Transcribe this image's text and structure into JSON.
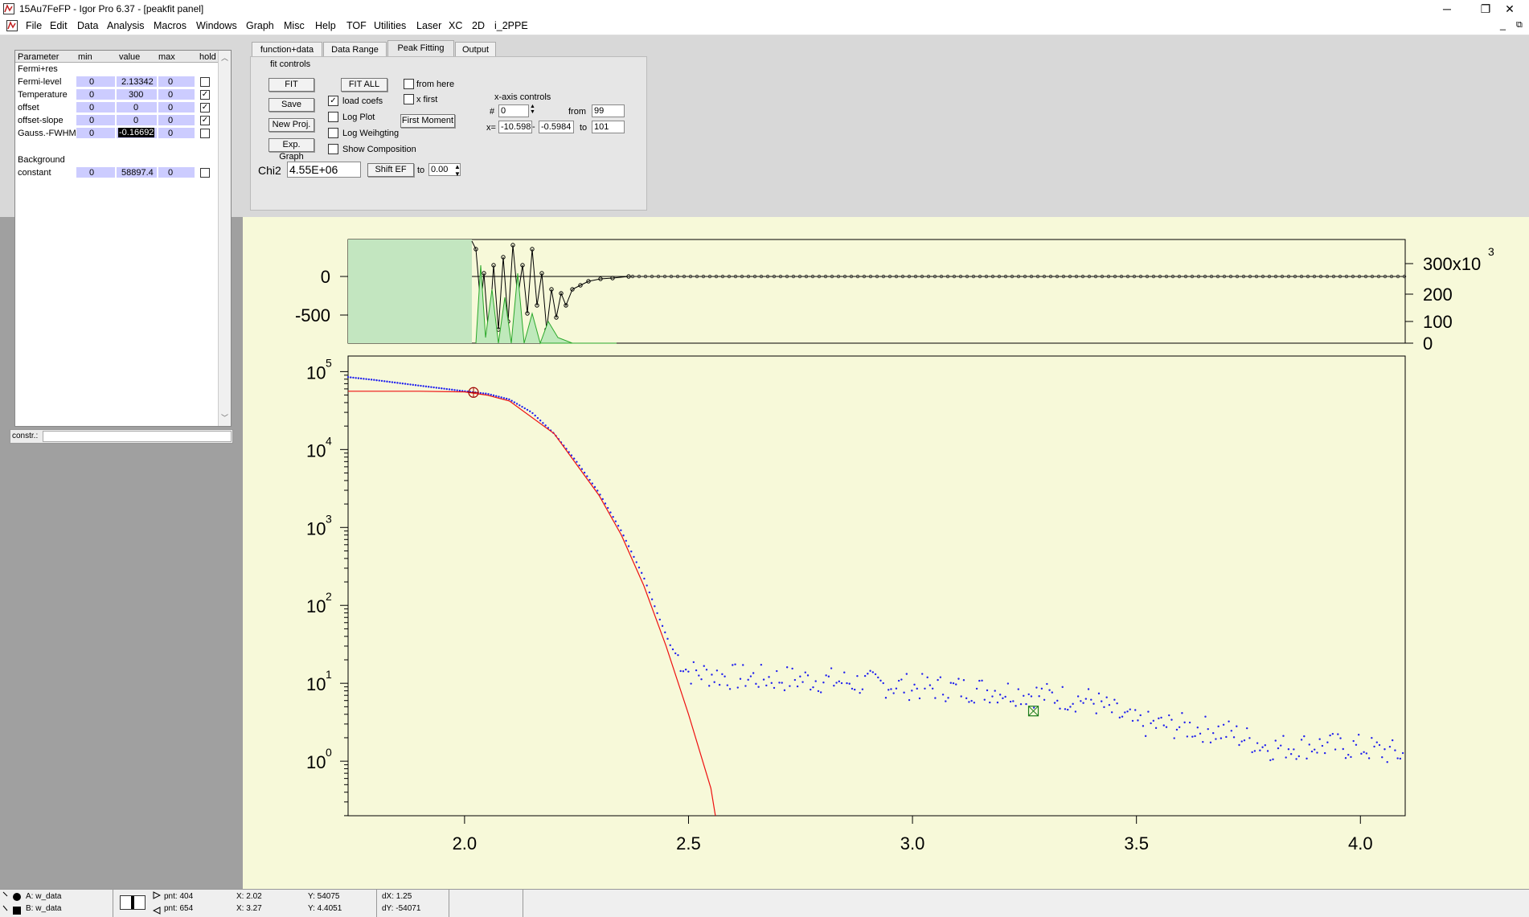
{
  "window": {
    "title": "15Au7FeFP - Igor Pro 6.37 - [peakfit panel]",
    "min_label": "─",
    "max_label": "❐",
    "close_label": "✕",
    "doc_min_label": "_",
    "doc_restore_label": "⧉"
  },
  "menu": [
    "File",
    "Edit",
    "Data",
    "Analysis",
    "Macros",
    "Windows",
    "Graph",
    "Misc",
    "Help",
    "TOF",
    "Utilities",
    "Laser",
    "XC",
    "2D",
    "i_2PPE"
  ],
  "param_table": {
    "headers": [
      "Parameter",
      "min",
      "value",
      "max",
      "hold"
    ],
    "groups": [
      {
        "name": "Fermi+res",
        "rows": [
          {
            "name": "Fermi-level",
            "min": "0",
            "value": "2.13342",
            "max": "0",
            "hold": false
          },
          {
            "name": "Temperature",
            "min": "0",
            "value": "300",
            "max": "0",
            "hold": true
          },
          {
            "name": "offset",
            "min": "0",
            "value": "0",
            "max": "0",
            "hold": true
          },
          {
            "name": "offset-slope",
            "min": "0",
            "value": "0",
            "max": "0",
            "hold": true
          },
          {
            "name": "Gauss.-FWHM",
            "min": "0",
            "value": "-0.16692",
            "max": "0",
            "hold": false
          }
        ]
      },
      {
        "name": "Background",
        "rows": [
          {
            "name": "constant",
            "min": "0",
            "value": "58897.4",
            "max": "0",
            "hold": false
          }
        ]
      }
    ],
    "constr_label": "constr.:",
    "constr_value": ""
  },
  "tabs": [
    "function+data",
    "Data Range",
    "Peak Fitting",
    "Output"
  ],
  "active_tab": "Peak Fitting",
  "fit": {
    "group_label": "fit controls",
    "fit_label": "FIT",
    "fit_all_label": "FIT ALL",
    "save_label": "Save",
    "new_proj_label": "New Proj.",
    "exp_graph_label": "Exp. Graph",
    "first_moment_label": "First Moment",
    "shift_ef_label": "Shift EF",
    "checks": {
      "from_here": "from here",
      "x_first": "x first",
      "load_coefs": "load coefs",
      "log_plot": "Log Plot",
      "log_weighting": "Log Weihgting",
      "show_composition": "Show Composition"
    },
    "checked": {
      "from_here": false,
      "x_first": false,
      "load_coefs": true,
      "log_plot": false,
      "log_weighting": false,
      "show_composition": false
    },
    "chi2_label": "Chi2",
    "chi2_value": "4.55E+06",
    "to_label": "to",
    "to_value": "0.00",
    "xaxis": {
      "title": "x-axis controls",
      "hash_label": "#",
      "hash_value": "0",
      "from_label": "from",
      "from_value": "99",
      "x_label": "x=",
      "x_min": "-10.598",
      "x_max": "-0.5984",
      "dash": "-",
      "to_label": "to",
      "to_value": "101"
    }
  },
  "chart_data": [
    {
      "type": "line",
      "title": "",
      "y_left_ticks": [
        "0",
        "-500"
      ],
      "y_right_ticks": [
        "0",
        "100",
        "200",
        "300x10"
      ],
      "y_right_exponent": "3",
      "series": []
    },
    {
      "type": "scatter",
      "title": "",
      "xlabel": "",
      "ylabel": "",
      "xlim": [
        1.74,
        4.1
      ],
      "ylim_log10": [
        -0.7,
        5.2
      ],
      "log_y": true,
      "x_ticks": [
        "2.0",
        "2.5",
        "3.0",
        "3.5",
        "4.0"
      ],
      "x_tick_values": [
        2.0,
        2.5,
        3.0,
        3.5,
        4.0
      ],
      "y_ticks_base": "10",
      "y_ticks_exp": [
        "5",
        "4",
        "3",
        "2",
        "1",
        "0"
      ],
      "y_tick_exp_values": [
        5,
        4,
        3,
        2,
        1,
        0
      ],
      "series": [
        {
          "kind": "data",
          "color": "#2020ee",
          "marker": "dot",
          "points": [
            [
              1.74,
              85000
            ],
            [
              1.8,
              78000
            ],
            [
              1.9,
              66000
            ],
            [
              2.0,
              56000
            ],
            [
              2.05,
              52000
            ],
            [
              2.1,
              44000
            ],
            [
              2.15,
              30000
            ],
            [
              2.2,
              16000
            ],
            [
              2.25,
              7000
            ],
            [
              2.3,
              2800
            ],
            [
              2.35,
              900
            ],
            [
              2.4,
              230
            ],
            [
              2.43,
              80
            ],
            [
              2.46,
              30
            ],
            [
              2.5,
              14
            ],
            [
              2.6,
              12
            ],
            [
              2.8,
              11
            ],
            [
              3.0,
              9
            ],
            [
              3.2,
              8
            ],
            [
              3.4,
              6
            ],
            [
              3.5,
              3
            ],
            [
              3.6,
              2.8
            ],
            [
              3.7,
              2.4
            ],
            [
              3.8,
              1.5
            ],
            [
              3.9,
              1.6
            ],
            [
              4.0,
              1.5
            ],
            [
              4.1,
              1.2
            ]
          ]
        },
        {
          "kind": "fit",
          "color": "#ee1010",
          "points": [
            [
              1.74,
              56000
            ],
            [
              1.9,
              56000
            ],
            [
              2.0,
              55000
            ],
            [
              2.05,
              50000
            ],
            [
              2.1,
              42000
            ],
            [
              2.2,
              16000
            ],
            [
              2.3,
              2600
            ],
            [
              2.35,
              800
            ],
            [
              2.4,
              180
            ],
            [
              2.45,
              30
            ],
            [
              2.5,
              4
            ],
            [
              2.55,
              0.45
            ],
            [
              2.56,
              0.2
            ]
          ]
        }
      ],
      "cursors": [
        {
          "name": "A",
          "x": 2.02,
          "y": 54075
        },
        {
          "name": "B",
          "x": 3.27,
          "y": 4.4051
        }
      ]
    }
  ],
  "status": {
    "a_label": "A: w_data",
    "b_label": "B: w_data",
    "a_pnt": "pnt: 404",
    "a_x": "X: 2.02",
    "a_y": "Y: 54075",
    "b_pnt": "pnt: 654",
    "b_x": "X: 3.27",
    "b_y": "Y: 4.4051",
    "dx": "dX: 1.25",
    "dy": "dY: -54071"
  }
}
